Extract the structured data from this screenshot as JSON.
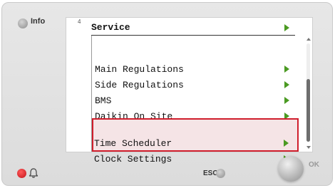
{
  "controller": {
    "info_label": "Info",
    "esc_label": "ESC",
    "ok_label": "OK",
    "alarm_led_color": "#d8232a",
    "highlight_color": "#d01e2c",
    "arrow_color": "#4a9a22"
  },
  "screen": {
    "page_number": "4",
    "title": "Service",
    "menu_items": [
      {
        "label": "Main Regulations",
        "icon": "arrow-right-icon"
      },
      {
        "label": "Side Regulations",
        "icon": "arrow-right-icon"
      },
      {
        "label": "BMS",
        "icon": "arrow-right-icon"
      },
      {
        "label": "Daikin On Site",
        "icon": "arrow-right-icon"
      },
      {
        "label": "Time Scheduler",
        "icon": "arrow-right-icon",
        "highlighted": true
      },
      {
        "label": "Clock Settings",
        "icon": "arrow-right-icon",
        "highlighted": true
      }
    ]
  }
}
